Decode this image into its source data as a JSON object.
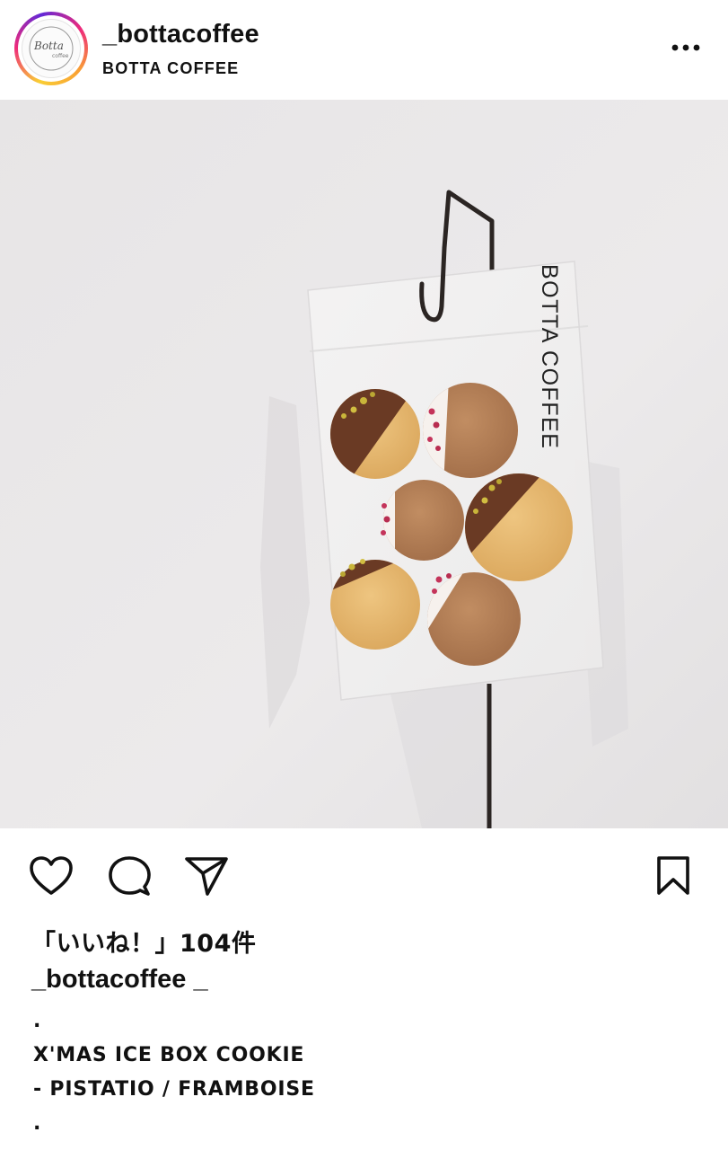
{
  "post": {
    "username": "_bottacoffee",
    "display_name": "BOTTA COFFEE",
    "avatar_text": "Botta",
    "avatar_subtext": "coffee",
    "bag_label": "BOTTA COFFEE",
    "likes_text": "「いいね！」104件",
    "caption_user": "_bottacoffee _",
    "caption_lines": [
      ".",
      "X'MAS ICE BOX COOKIE",
      "- PISTATIO / FRAMBOISE",
      "."
    ]
  },
  "icons": {
    "more": "more-options-icon",
    "like": "heart-icon",
    "comment": "comment-bubble-icon",
    "share": "paper-plane-icon",
    "save": "bookmark-icon"
  },
  "colors": {
    "accent_ring": [
      "#f9ce34",
      "#ee2a7b",
      "#6228d7"
    ],
    "text": "#111111"
  }
}
